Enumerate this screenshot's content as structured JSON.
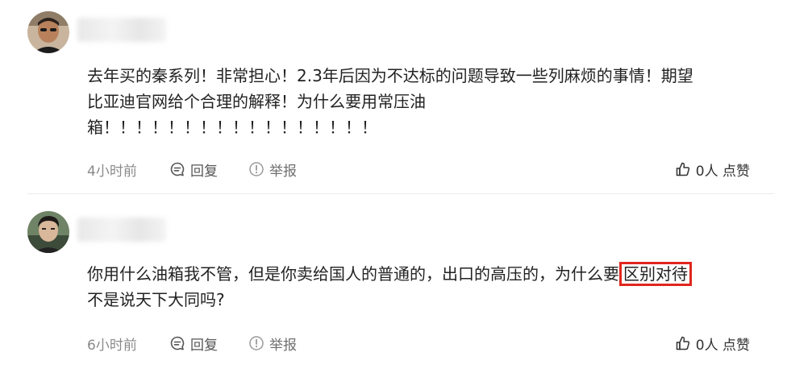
{
  "comments": [
    {
      "text": "去年买的秦系列！非常担心！2.3年后因为不达标的问题导致一些列麻烦的事情！期望\n比亚迪官网给个合理的解释！为什么要用常压油\n箱！！！！！！！！！！！！！！！！！",
      "time": "4小时前",
      "reply_label": "回复",
      "report_label": "举报",
      "like_label": "0人 点赞"
    },
    {
      "text_before": "你用什么油箱我不管，但是你卖给国人的普通的，出口的高压的，为什么要",
      "text_highlight": "区别对待",
      "text_after": "\n不是说天下大同吗?",
      "time": "6小时前",
      "reply_label": "回复",
      "report_label": "举报",
      "like_label": "0人 点赞"
    }
  ],
  "colors": {
    "highlight_border": "#e0261d",
    "text": "#222222",
    "meta": "#8a8a8a"
  },
  "icons": {
    "reply": "comment-bubble-icon",
    "report": "exclamation-circle-icon",
    "like": "thumbs-up-icon"
  }
}
